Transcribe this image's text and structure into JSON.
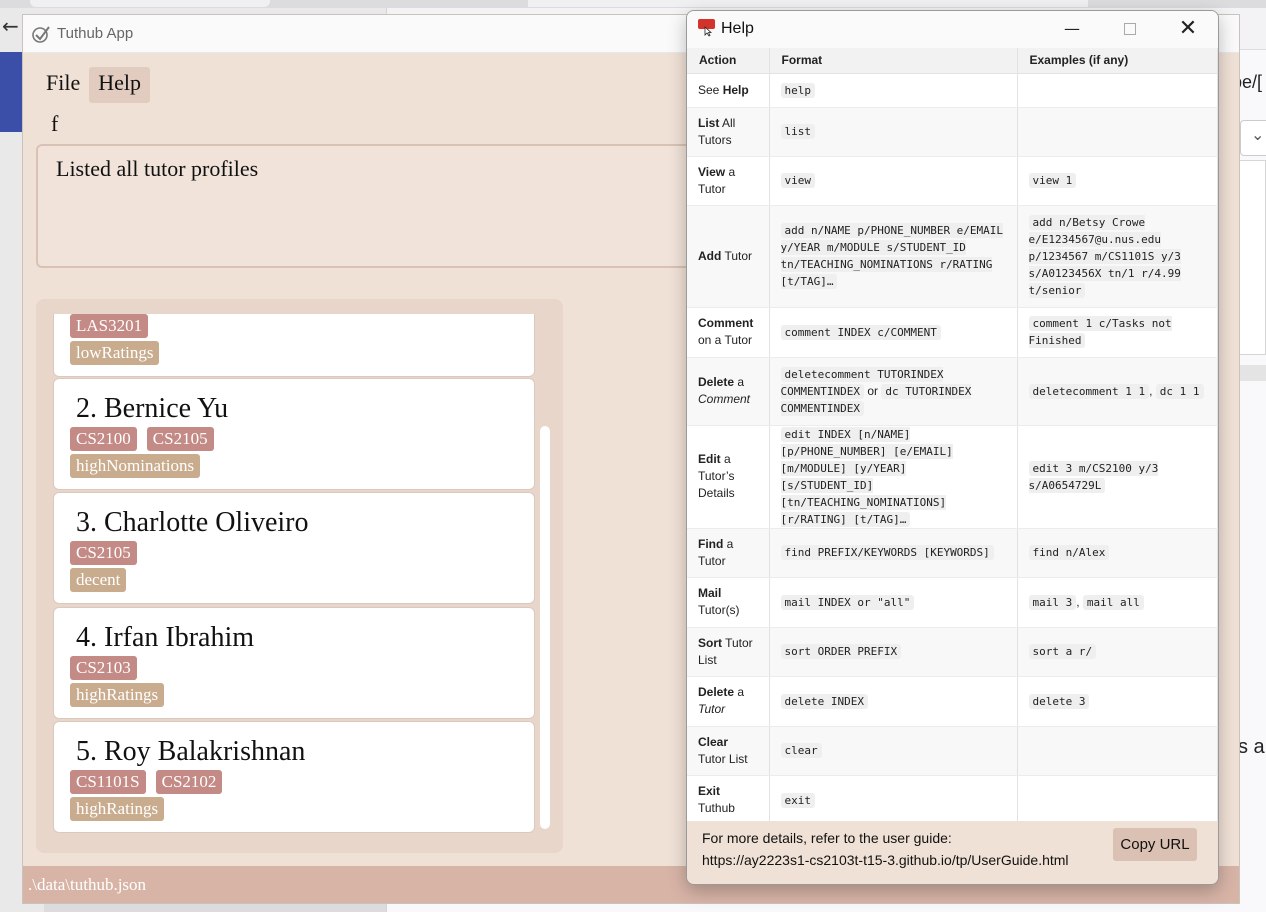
{
  "app": {
    "title": "Tuthub App",
    "menus": [
      "File",
      "Help"
    ],
    "command_input": "f",
    "result": "Listed all tutor profiles",
    "status_path": ".\\data\\tuthub.json",
    "tutors": [
      {
        "name": "",
        "tags_modules": [
          "LAS3201"
        ],
        "tags_rating": [
          "lowRatings"
        ]
      },
      {
        "name": "2.  Bernice Yu",
        "tags_modules": [
          "CS2100",
          "CS2105"
        ],
        "tags_rating": [
          "highNominations"
        ]
      },
      {
        "name": "3.  Charlotte Oliveiro",
        "tags_modules": [
          "CS2105"
        ],
        "tags_rating": [
          "decent"
        ]
      },
      {
        "name": "4.  Irfan Ibrahim",
        "tags_modules": [
          "CS2103"
        ],
        "tags_rating": [
          "highRatings"
        ]
      },
      {
        "name": "5.  Roy Balakrishnan",
        "tags_modules": [
          "CS1101S",
          "CS2102"
        ],
        "tags_rating": [
          "highRatings"
        ]
      }
    ]
  },
  "help": {
    "title": "Help",
    "headers": [
      "Action",
      "Format",
      "Examples (if any)"
    ],
    "footer_line1": "For more details, refer to the user guide:",
    "footer_line2": "https://ay2223s1-cs2103t-t15-3.github.io/tp/UserGuide.html",
    "copy_button": "Copy URL"
  },
  "background": {
    "url_fragment": "pe/[",
    "side_text": "s a"
  },
  "colors": {
    "accent": "#d8b4a7",
    "module_tag": "#c48a86",
    "rating_tag": "#c9ab8e"
  }
}
